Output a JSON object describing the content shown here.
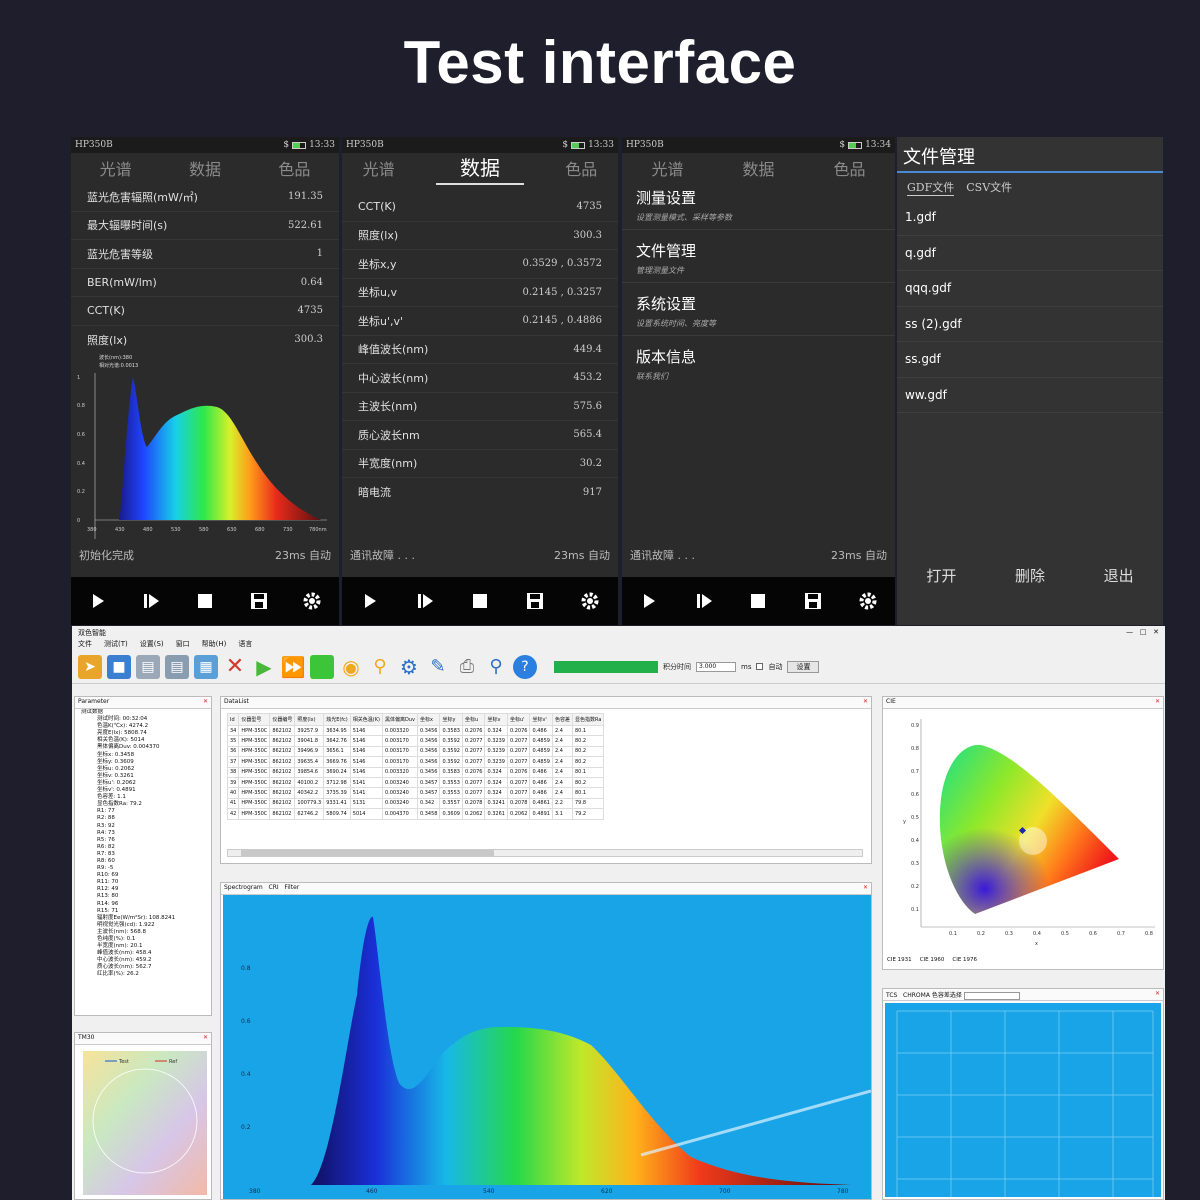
{
  "page_title": "Test interface",
  "phones": [
    {
      "device": "HP350B",
      "time": "13:33",
      "tabs": [
        "光谱",
        "数据",
        "色品"
      ],
      "active_tab": 0,
      "rows": [
        {
          "label": "蓝光危害辐照(mW/㎡)",
          "value": "191.35"
        },
        {
          "label": "最大辐曝时间(s)",
          "value": "522.61"
        },
        {
          "label": "蓝光危害等级",
          "value": "1"
        },
        {
          "label": "BER(mW/lm)",
          "value": "0.64"
        },
        {
          "label": "CCT(K)",
          "value": "4735"
        },
        {
          "label": "照度(lx)",
          "value": "300.3"
        }
      ],
      "chart_caption_1": "波长(nm):380",
      "chart_caption_2": "相对光谱:0.0013",
      "y_ticks": [
        "1",
        "0.8",
        "0.6",
        "0.4",
        "0.2",
        "0"
      ],
      "x_ticks": [
        "380",
        "430",
        "480",
        "530",
        "580",
        "630",
        "680",
        "730",
        "780nm"
      ],
      "status_left": "初始化完成",
      "status_right": "23ms 自动"
    },
    {
      "device": "HP350B",
      "time": "13:33",
      "tabs": [
        "光谱",
        "数据",
        "色品"
      ],
      "active_tab": 1,
      "rows": [
        {
          "label": "CCT(K)",
          "value": "4735"
        },
        {
          "label": "照度(lx)",
          "value": "300.3"
        },
        {
          "label": "坐标x,y",
          "value": "0.3529 ,  0.3572"
        },
        {
          "label": "坐标u,v",
          "value": "0.2145 ,  0.3257"
        },
        {
          "label": "坐标u',v'",
          "value": "0.2145 ,  0.4886"
        },
        {
          "label": "峰值波长(nm)",
          "value": "449.4"
        },
        {
          "label": "中心波长(nm)",
          "value": "453.2"
        },
        {
          "label": "主波长(nm)",
          "value": "575.6"
        },
        {
          "label": "质心波长nm",
          "value": "565.4"
        },
        {
          "label": "半宽度(nm)",
          "value": "30.2"
        },
        {
          "label": "暗电流",
          "value": "917"
        }
      ],
      "status_left": "通讯故障 . . .",
      "status_right": "23ms 自动"
    },
    {
      "device": "HP350B",
      "time": "13:34",
      "tabs": [
        "光谱",
        "数据",
        "色品"
      ],
      "active_tab": -1,
      "menu": [
        {
          "title": "测量设置",
          "sub": "设置测量模式、采样等参数"
        },
        {
          "title": "文件管理",
          "sub": "管理测量文件"
        },
        {
          "title": "系统设置",
          "sub": "设置系统时间、亮度等"
        },
        {
          "title": "版本信息",
          "sub": "联系我们"
        }
      ],
      "status_left": "通讯故障 . . .",
      "status_right": "23ms 自动"
    }
  ],
  "files": {
    "header": "文件管理",
    "tabs": [
      "GDF文件",
      "CSV文件"
    ],
    "items": [
      "1.gdf",
      "q.gdf",
      "qqq.gdf",
      "ss (2).gdf",
      "ss.gdf",
      "ww.gdf"
    ],
    "buttons": [
      "打开",
      "删除",
      "退出"
    ]
  },
  "app": {
    "window_title": "双色智能",
    "menus": [
      "文件",
      "测试(T)",
      "设置(S)",
      "窗口",
      "帮助(H)",
      "语言"
    ],
    "integration_label": "积分时间",
    "integration_value": "3.000",
    "unit": "ms",
    "auto_label": "自动",
    "settings_button": "设置",
    "parameter_panel": "Parameter",
    "datalist_panel": "DataList",
    "cie_panel": "CIE",
    "tcs_panel": "TCS",
    "cri_panel": "TM30",
    "spec_tabs": [
      "Spectrogram",
      "CRI",
      "Filter"
    ],
    "cie_tabs": [
      "CIE 1931",
      "CIE 1960",
      "CIE 1976"
    ],
    "tcs_tabs": [
      "TCS",
      "CHROMA",
      "色容差选择"
    ],
    "cri_legend": [
      "Test",
      "Ref"
    ],
    "tree": [
      "测试数据",
      "测试时间: 00:32:04",
      "色温K(℃x): 4274.2",
      "亮度E(lx): 5808.74",
      "相关色温(K): 5014",
      "黑体偏离Duv: 0.004370",
      "坐标x: 0.3458",
      "坐标y: 0.3609",
      "坐标u: 0.2062",
      "坐标v: 0.3261",
      "坐标u': 0.2062",
      "坐标v': 0.4891",
      "色容差: 1.1",
      "显色指数Ra: 79.2",
      "R1: 77",
      "R2: 88",
      "R3: 92",
      "R4: 73",
      "R5: 76",
      "R6: 82",
      "R7: 83",
      "R8: 60",
      "R9: -5",
      "R10: 69",
      "R11: 70",
      "R12: 49",
      "R13: 80",
      "R14: 96",
      "R15: 71",
      "辐射度Ee(W/m²Sr): 108.8241",
      "明视觉光强(cd): 1.922",
      "主波长(nm): 568.8",
      "色纯度(%): 0.1",
      "半宽度(nm): 20.1",
      "峰值波长(nm): 458.4",
      "中心波长(nm): 459.2",
      "质心波长(nm): 562.7",
      "红比率(%): 26.2"
    ],
    "table_headers": [
      "Id",
      "仪器型号",
      "仪器编号",
      "照度(lx)",
      "烛光E(fc)",
      "相关色温(K)",
      "黑体偏离Duv",
      "坐标x",
      "坐标y",
      "坐标u",
      "坐标v",
      "坐标u'",
      "坐标v'",
      "色容差",
      "显色指数Ra"
    ],
    "table_rows": [
      [
        "34",
        "HPM-350C",
        "862102",
        "39257.9",
        "3634.95",
        "5146",
        "0.003320",
        "0.3456",
        "0.3583",
        "0.2076",
        "0.324",
        "0.2076",
        "0.486",
        "2.4",
        "80.1"
      ],
      [
        "35",
        "HPM-350C",
        "862102",
        "39041.8",
        "3642.76",
        "5146",
        "0.003170",
        "0.3456",
        "0.3592",
        "0.2077",
        "0.3239",
        "0.2077",
        "0.4859",
        "2.4",
        "80.2"
      ],
      [
        "36",
        "HPM-350C",
        "862102",
        "39496.9",
        "3656.1",
        "5146",
        "0.003170",
        "0.3456",
        "0.3592",
        "0.2077",
        "0.3239",
        "0.2077",
        "0.4859",
        "2.4",
        "80.2"
      ],
      [
        "37",
        "HPM-350C",
        "862102",
        "39635.4",
        "3669.76",
        "5146",
        "0.003170",
        "0.3456",
        "0.3592",
        "0.2077",
        "0.3239",
        "0.2077",
        "0.4859",
        "2.4",
        "80.2"
      ],
      [
        "38",
        "HPM-350C",
        "862102",
        "39854.6",
        "3690.24",
        "5146",
        "0.003320",
        "0.3456",
        "0.3583",
        "0.2076",
        "0.324",
        "0.2076",
        "0.486",
        "2.4",
        "80.1"
      ],
      [
        "39",
        "HPM-350C",
        "862102",
        "40100.2",
        "3712.98",
        "5141",
        "0.003240",
        "0.3457",
        "0.3553",
        "0.2077",
        "0.324",
        "0.2077",
        "0.486",
        "2.4",
        "80.2"
      ],
      [
        "40",
        "HPM-350C",
        "862102",
        "40342.2",
        "3735.39",
        "5141",
        "0.003240",
        "0.3457",
        "0.3553",
        "0.2077",
        "0.324",
        "0.2077",
        "0.486",
        "2.4",
        "80.1"
      ],
      [
        "41",
        "HPM-350C",
        "862102",
        "100779.3",
        "9331.41",
        "5131",
        "0.003240",
        "0.342",
        "0.3557",
        "0.2078",
        "0.3241",
        "0.2078",
        "0.4861",
        "2.2",
        "79.8"
      ],
      [
        "42",
        "HPM-350C",
        "862102",
        "62746.2",
        "5809.74",
        "5014",
        "0.004370",
        "0.3458",
        "0.3609",
        "0.2062",
        "0.3261",
        "0.2062",
        "0.4891",
        "3.1",
        "79.2"
      ]
    ],
    "spec_y_ticks": [
      "0.8",
      "0.6",
      "0.4",
      "0.2"
    ],
    "spec_x_ticks": [
      "380",
      "460",
      "540",
      "620",
      "700",
      "780"
    ],
    "cie_y_ticks": [
      "0.9",
      "0.8",
      "0.7",
      "0.6",
      "0.5",
      "0.4",
      "0.3",
      "0.2",
      "0.1"
    ],
    "cie_x_ticks": [
      "0.1",
      "0.2",
      "0.3",
      "0.4",
      "0.5",
      "0.6",
      "0.7",
      "0.8"
    ],
    "cie_x_label": "x",
    "cie_y_label": "y"
  },
  "colors": {
    "page_bg": "#1e1e2c",
    "phone_bg": "#2b2b2b",
    "spectrum_bg": "#1aa4e8",
    "progress": "#23b04a"
  },
  "icons": [
    "play-icon",
    "step-icon",
    "stop-icon",
    "save-icon",
    "gear-icon"
  ]
}
